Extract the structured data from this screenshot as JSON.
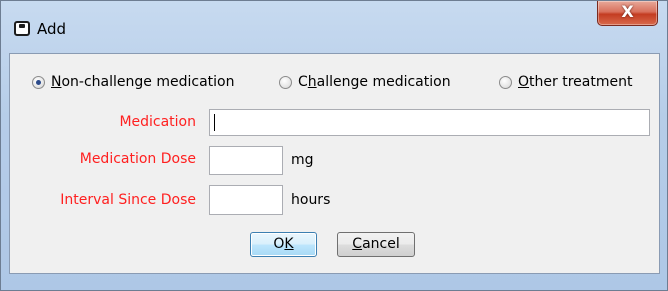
{
  "window": {
    "title": "Add",
    "close_label": "X"
  },
  "treatment_type": {
    "options": [
      {
        "label_mnemonic": "N",
        "label_rest": "on-challenge medication",
        "selected": true
      },
      {
        "label_pre": "C",
        "label_mnemonic": "h",
        "label_rest": "allenge medication",
        "selected": false
      },
      {
        "label_mnemonic": "O",
        "label_rest": "ther treatment",
        "selected": false
      }
    ]
  },
  "form": {
    "medication_label": "Medication",
    "medication_value": "",
    "dose_label": "Medication Dose",
    "dose_value": "",
    "dose_unit": "mg",
    "interval_label": "Interval Since Dose",
    "interval_value": "",
    "interval_unit": "hours"
  },
  "buttons": {
    "ok_pre": "O",
    "ok_mnemonic": "K",
    "cancel_mnemonic": "C",
    "cancel_rest": "ancel"
  },
  "colors": {
    "required_label": "#ff2020"
  }
}
